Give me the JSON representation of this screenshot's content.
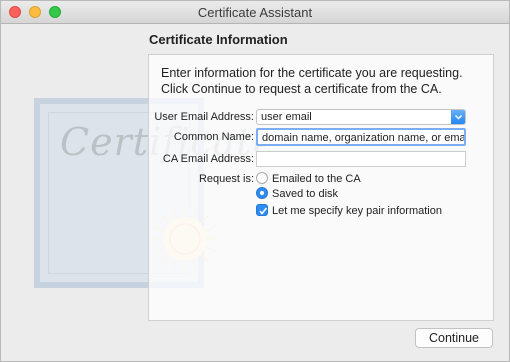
{
  "window": {
    "title": "Certificate Assistant"
  },
  "art": {
    "script": "Certificate"
  },
  "heading": "Certificate Information",
  "intro": "Enter information for the certificate you are requesting. Click Continue to request a certificate from the CA.",
  "form": {
    "user_email": {
      "label": "User Email Address:",
      "value": "user email"
    },
    "common_name": {
      "label": "Common Name:",
      "value": "domain name, organization name, or email"
    },
    "ca_email": {
      "label": "CA Email Address:",
      "value": ""
    },
    "request_is": {
      "label": "Request is:",
      "options": [
        {
          "label": "Emailed to the CA",
          "selected": false
        },
        {
          "label": "Saved to disk",
          "selected": true
        }
      ]
    },
    "key_pair": {
      "label": "Let me specify key pair information",
      "checked": true
    }
  },
  "buttons": {
    "continue": "Continue"
  },
  "colors": {
    "accent": "#2f8cf0",
    "close": "#fc605c",
    "minimize": "#fdbc40",
    "maximize": "#34c84a"
  }
}
